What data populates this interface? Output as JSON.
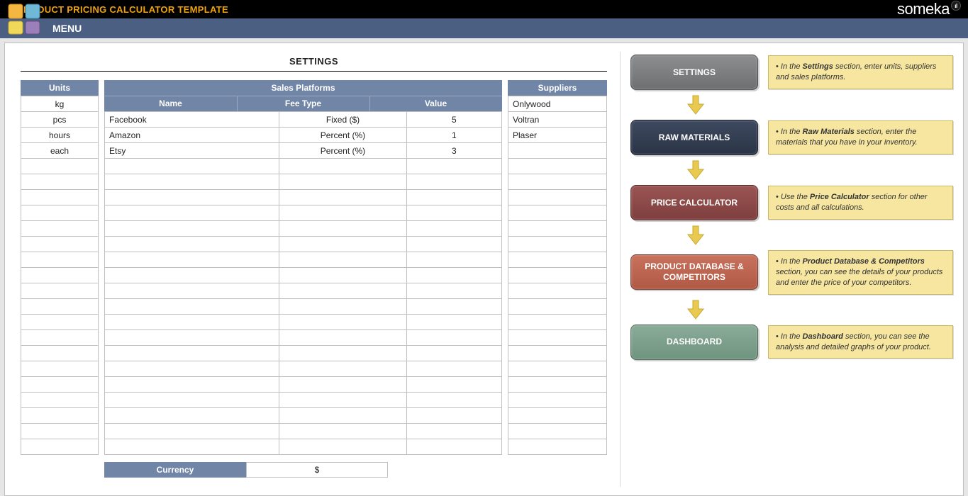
{
  "header": {
    "title": "PRODUCT PRICING CALCULATOR TEMPLATE",
    "menu": "MENU",
    "brand": "someka"
  },
  "settings": {
    "title": "SETTINGS",
    "units_header": "Units",
    "units": [
      "kg",
      "pcs",
      "hours",
      "each",
      "",
      "",
      "",
      "",
      "",
      "",
      "",
      "",
      "",
      "",
      "",
      "",
      "",
      "",
      "",
      "",
      "",
      "",
      ""
    ],
    "platforms_header": "Sales Platforms",
    "platforms_sub": {
      "name": "Name",
      "fee": "Fee Type",
      "val": "Value"
    },
    "platforms": [
      {
        "name": "Facebook",
        "fee": "Fixed ($)",
        "val": "5"
      },
      {
        "name": "Amazon",
        "fee": "Percent (%)",
        "val": "1"
      },
      {
        "name": "Etsy",
        "fee": "Percent (%)",
        "val": "3"
      },
      {
        "name": "",
        "fee": "",
        "val": ""
      },
      {
        "name": "",
        "fee": "",
        "val": ""
      },
      {
        "name": "",
        "fee": "",
        "val": ""
      },
      {
        "name": "",
        "fee": "",
        "val": ""
      },
      {
        "name": "",
        "fee": "",
        "val": ""
      },
      {
        "name": "",
        "fee": "",
        "val": ""
      },
      {
        "name": "",
        "fee": "",
        "val": ""
      },
      {
        "name": "",
        "fee": "",
        "val": ""
      },
      {
        "name": "",
        "fee": "",
        "val": ""
      },
      {
        "name": "",
        "fee": "",
        "val": ""
      },
      {
        "name": "",
        "fee": "",
        "val": ""
      },
      {
        "name": "",
        "fee": "",
        "val": ""
      },
      {
        "name": "",
        "fee": "",
        "val": ""
      },
      {
        "name": "",
        "fee": "",
        "val": ""
      },
      {
        "name": "",
        "fee": "",
        "val": ""
      },
      {
        "name": "",
        "fee": "",
        "val": ""
      },
      {
        "name": "",
        "fee": "",
        "val": ""
      },
      {
        "name": "",
        "fee": "",
        "val": ""
      },
      {
        "name": "",
        "fee": "",
        "val": ""
      }
    ],
    "suppliers_header": "Suppliers",
    "suppliers": [
      "Onlywood",
      "Voltran",
      "Plaser",
      "",
      "",
      "",
      "",
      "",
      "",
      "",
      "",
      "",
      "",
      "",
      "",
      "",
      "",
      "",
      "",
      "",
      "",
      "",
      ""
    ],
    "currency_label": "Currency",
    "currency_value": "$"
  },
  "flow": {
    "settings": {
      "label": "SETTINGS",
      "note_bold": "Settings",
      "note_rest": " section, enter units, suppliers and sales platforms.",
      "note_pre": "In the "
    },
    "raw": {
      "label": "RAW MATERIALS",
      "note_bold": "Raw Materials",
      "note_rest": " section, enter the materials that you have in your inventory.",
      "note_pre": "In the "
    },
    "price": {
      "label": "PRICE CALCULATOR",
      "note_bold": "Price Calculator",
      "note_rest": " section for other costs and all calculations.",
      "note_pre": "Use the "
    },
    "db": {
      "label": "PRODUCT DATABASE & COMPETITORS",
      "note_bold": "Product Database & Competitors",
      "note_rest": " section, you can see the details of your products and enter the price of your competitors.",
      "note_pre": "In the "
    },
    "dash": {
      "label": "DASHBOARD",
      "note_bold": "Dashboard",
      "note_rest": " section, you can see the analysis and detailed graphs of your product.",
      "note_pre": "In the "
    }
  }
}
